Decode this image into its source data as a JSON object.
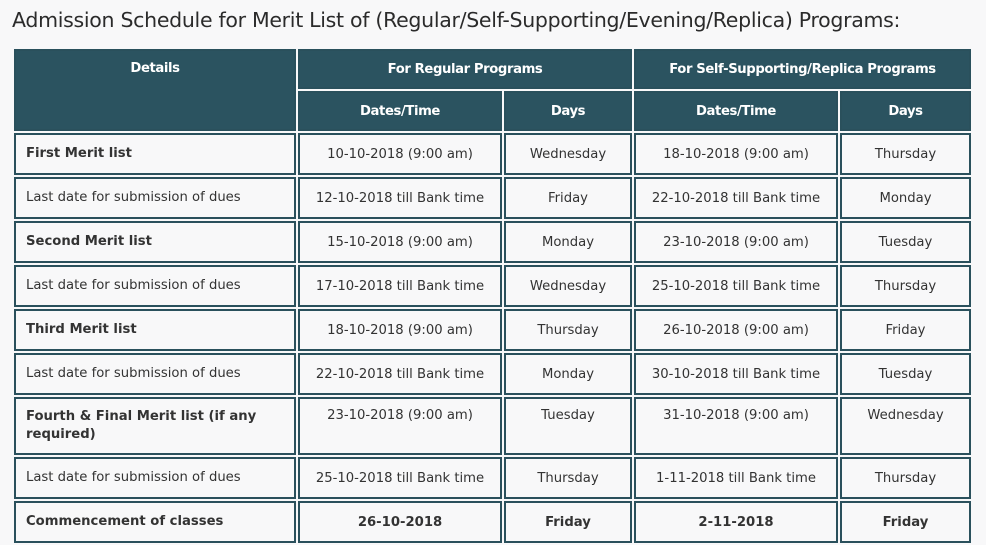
{
  "title": "Admission Schedule for Merit List of (Regular/Self-Supporting/Evening/Replica) Programs:",
  "colors": {
    "header_bg": "#2b5360",
    "border": "#2a505c",
    "header_text": "#ffffff"
  },
  "table": {
    "headers": {
      "details": "Details",
      "regular_group": "For Regular Programs",
      "self_group": "For Self-Supporting/Replica Programs",
      "regular_dates": "Dates/Time",
      "regular_days": "Days",
      "self_dates": "Dates/Time",
      "self_days": "Days"
    },
    "rows": [
      {
        "detail": "First Merit list",
        "bold": true,
        "reg_date": "10-10-2018 (9:00 am)",
        "reg_day": "Wednesday",
        "self_date": "18-10-2018 (9:00 am)",
        "self_day": "Thursday"
      },
      {
        "detail": "Last date for submission of dues",
        "bold": false,
        "reg_date": "12-10-2018 till Bank time",
        "reg_day": "Friday",
        "self_date": "22-10-2018 till Bank time",
        "self_day": "Monday"
      },
      {
        "detail": "Second Merit list",
        "bold": true,
        "reg_date": "15-10-2018 (9:00 am)",
        "reg_day": "Monday",
        "self_date": "23-10-2018 (9:00 am)",
        "self_day": "Tuesday"
      },
      {
        "detail": "Last date for submission of dues",
        "bold": false,
        "reg_date": "17-10-2018 till Bank time",
        "reg_day": "Wednesday",
        "self_date": "25-10-2018 till Bank time",
        "self_day": "Thursday"
      },
      {
        "detail": "Third Merit list",
        "bold": true,
        "reg_date": "18-10-2018 (9:00 am)",
        "reg_day": "Thursday",
        "self_date": "26-10-2018 (9:00 am)",
        "self_day": "Friday"
      },
      {
        "detail": "Last date for submission of dues",
        "bold": false,
        "reg_date": "22-10-2018 till Bank time",
        "reg_day": "Monday",
        "self_date": "30-10-2018 till Bank time",
        "self_day": "Tuesday"
      },
      {
        "detail": "Fourth & Final Merit list (if any required)",
        "bold": true,
        "reg_date": "23-10-2018 (9:00 am)",
        "reg_day": "Tuesday",
        "self_date": "31-10-2018 (9:00 am)",
        "self_day": "Wednesday"
      },
      {
        "detail": "Last date for submission of dues",
        "bold": false,
        "reg_date": "25-10-2018 till Bank time",
        "reg_day": "Thursday",
        "self_date": "1-11-2018 till Bank time",
        "self_day": "Thursday"
      },
      {
        "detail": "Commencement of classes",
        "bold": true,
        "all_bold": true,
        "reg_date": "26-10-2018",
        "reg_day": "Friday",
        "self_date": "2-11-2018",
        "self_day": "Friday"
      }
    ]
  }
}
